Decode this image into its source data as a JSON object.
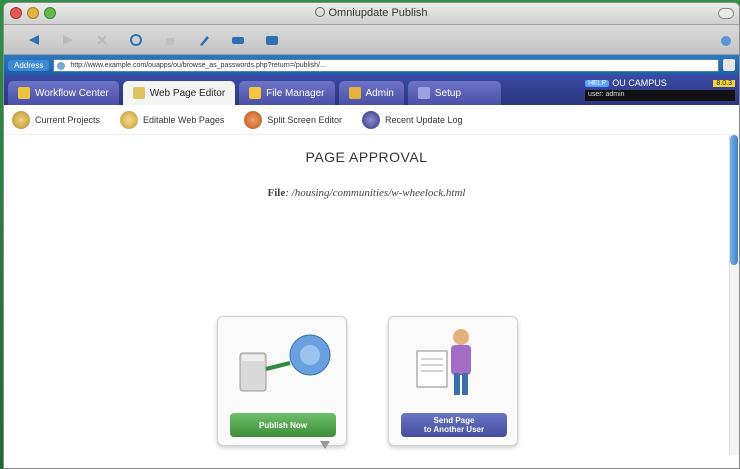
{
  "window": {
    "title": "Omniupdate Publish"
  },
  "addressbar": {
    "label": "Address",
    "url": "http://www.example.com/ouapps/ou/browse_as_passwords.php?return=/publish/..."
  },
  "tabs": [
    {
      "label": "Workflow Center",
      "active": false,
      "icon": "workflow-icon"
    },
    {
      "label": "Web Page Editor",
      "active": true,
      "icon": "edit-icon"
    },
    {
      "label": "File Manager",
      "active": false,
      "icon": "folder-icon"
    },
    {
      "label": "Admin",
      "active": false,
      "icon": "admin-icon"
    },
    {
      "label": "Setup",
      "active": false,
      "icon": "setup-icon"
    }
  ],
  "tabbar_right": {
    "badge": "HELP",
    "site": "OU CAMPUS",
    "version": "8.0.3",
    "user": "user: admin"
  },
  "subnav": [
    {
      "label": "Current Projects",
      "icon": "projects-icon",
      "color": "#c9a24a"
    },
    {
      "label": "Editable Web Pages",
      "icon": "pages-icon",
      "color": "#d4b04e"
    },
    {
      "label": "Split Screen Editor",
      "icon": "split-icon",
      "color": "#d8743a"
    },
    {
      "label": "Recent Update Log",
      "icon": "log-icon",
      "color": "#4a4e8c"
    }
  ],
  "main": {
    "title": "PAGE APPROVAL",
    "file_label": "File",
    "file_path": ": /housing/communities/w-wheelock.html"
  },
  "cards": {
    "publish": {
      "label": "Publish Now",
      "icon": "publish-icon"
    },
    "send": {
      "label_line1": "Send Page",
      "label_line2": "to Another User",
      "icon": "user-icon"
    }
  },
  "colors": {
    "tabbar": "#3c4aa5",
    "addressbar": "#2b78c4",
    "publish_button": "#4f9f4a",
    "send_button": "#545db0"
  }
}
